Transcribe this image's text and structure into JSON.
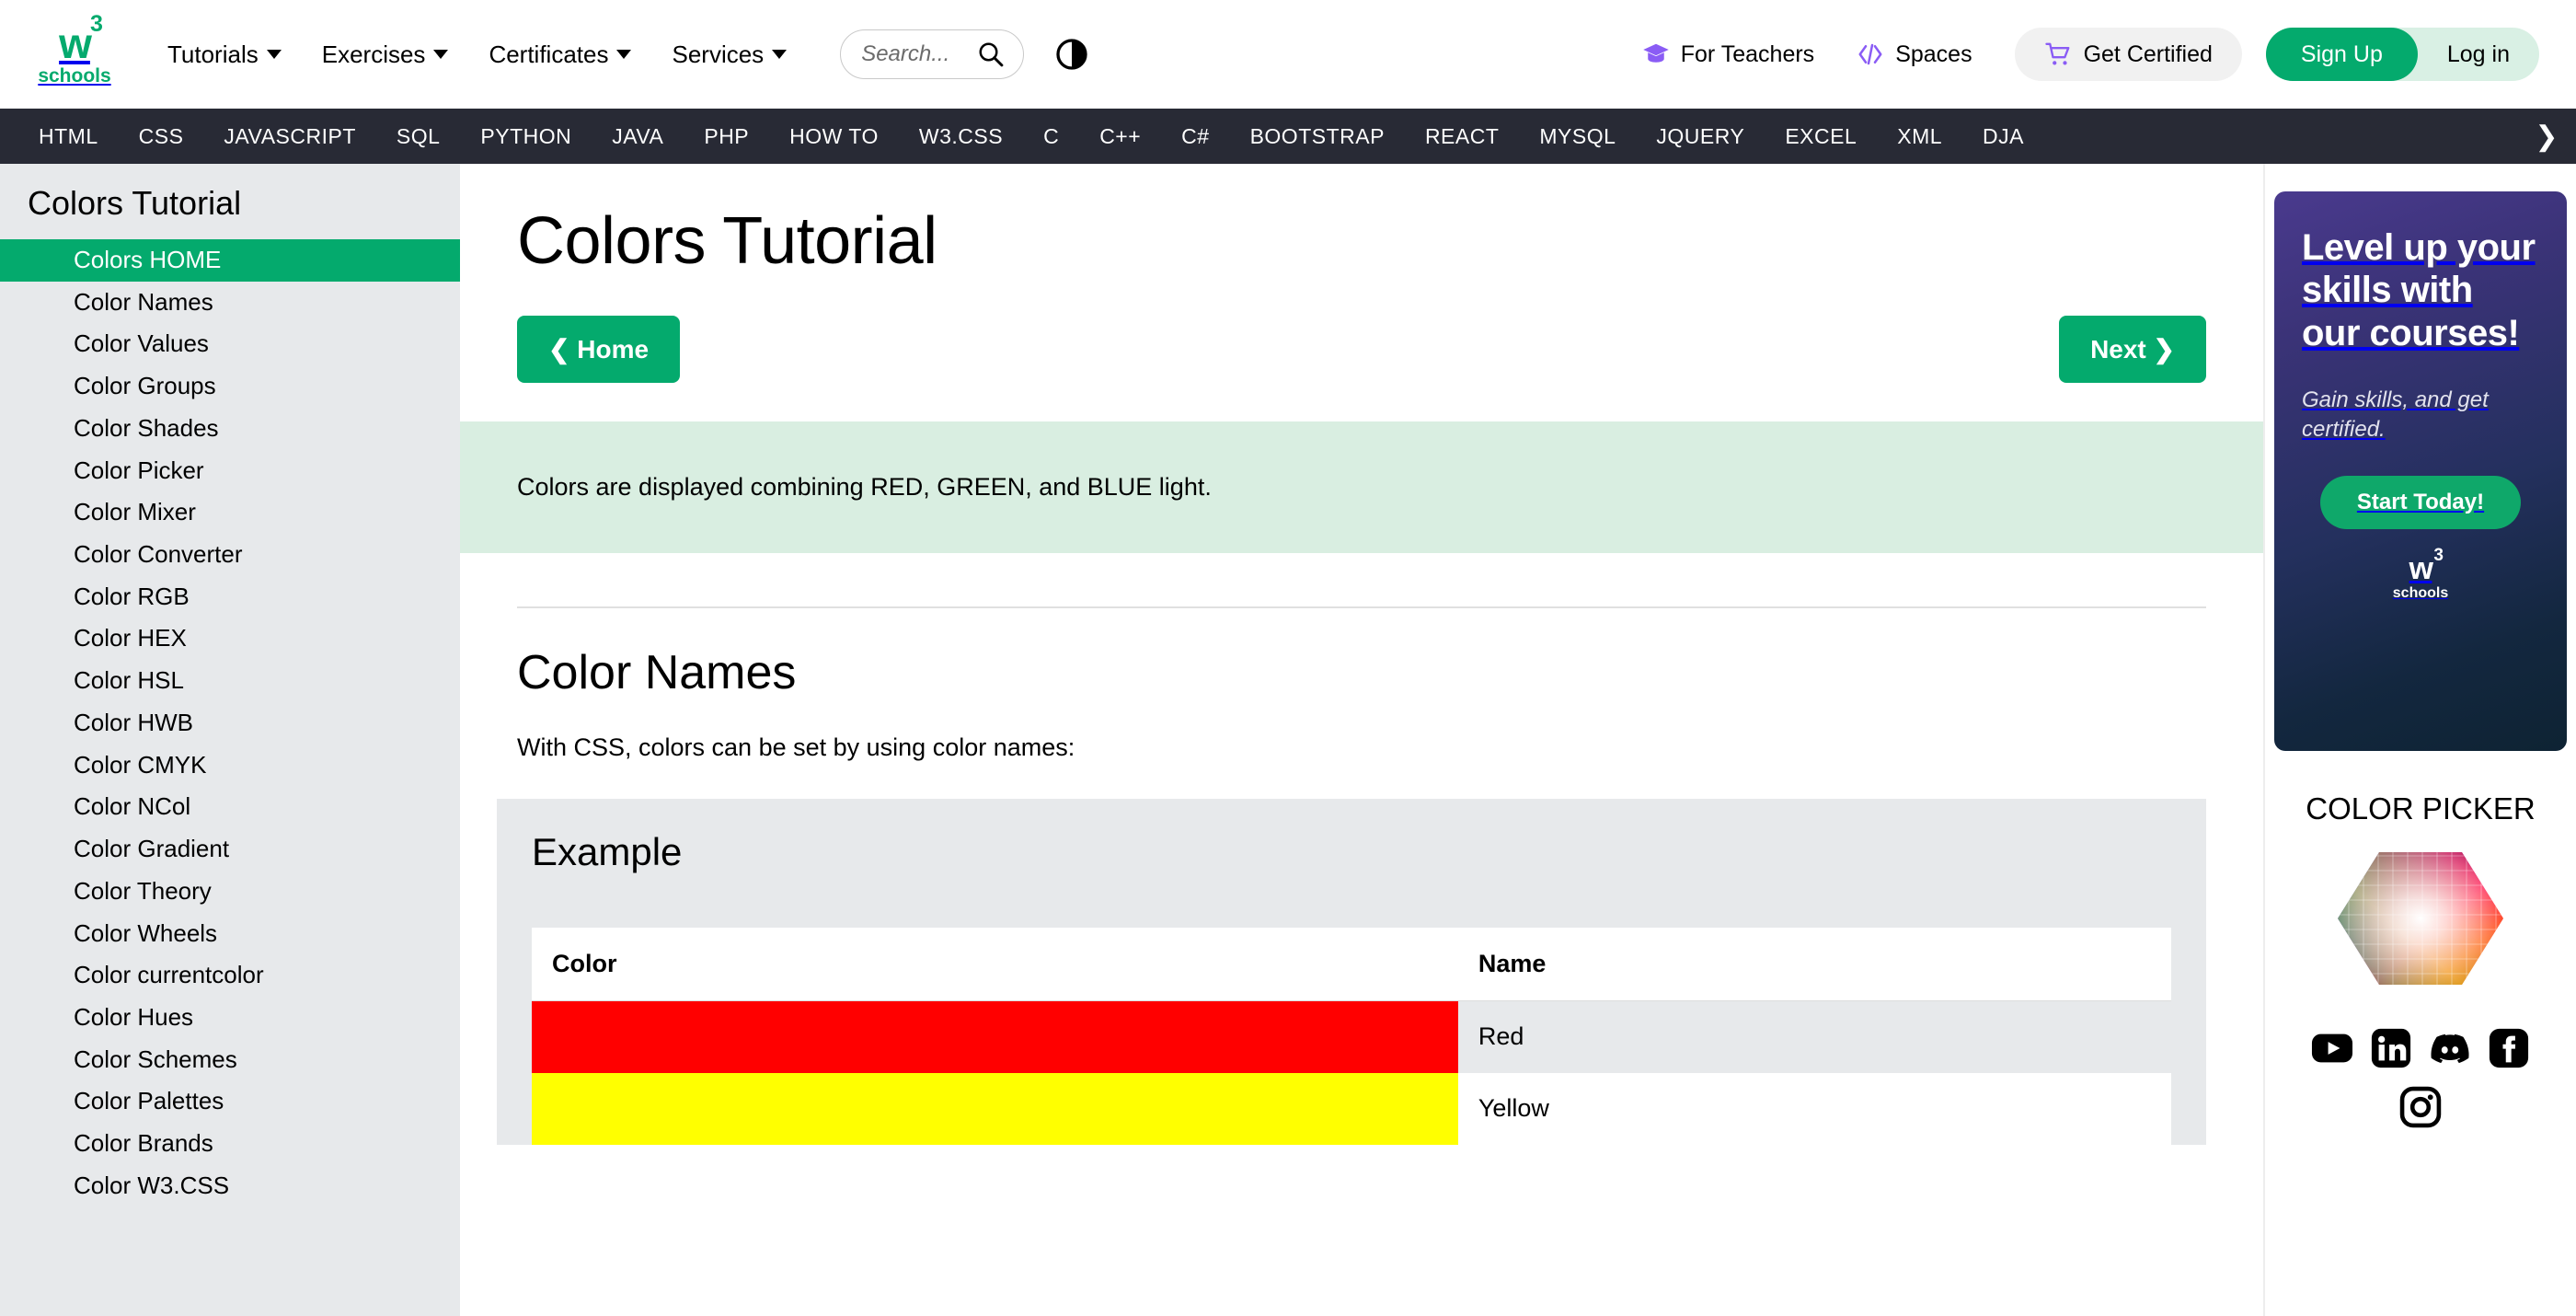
{
  "header": {
    "logo": {
      "mark": "w",
      "super": "3",
      "sub": "schools"
    },
    "menu": [
      {
        "label": "Tutorials",
        "has_caret": true
      },
      {
        "label": "Exercises",
        "has_caret": true
      },
      {
        "label": "Certificates",
        "has_caret": true
      },
      {
        "label": "Services",
        "has_caret": true
      }
    ],
    "search": {
      "placeholder": "Search...",
      "value": "",
      "icon": "search-icon"
    },
    "dark_mode_icon": "contrast-icon",
    "right_links": [
      {
        "label": "For Teachers",
        "icon": "graduation-cap-icon"
      },
      {
        "label": "Spaces",
        "icon": "code-brackets-icon"
      }
    ],
    "get_certified": {
      "label": "Get Certified",
      "icon": "shopping-cart-icon"
    },
    "sign_up": "Sign Up",
    "log_in": "Log in"
  },
  "nav": {
    "items": [
      "HTML",
      "CSS",
      "JAVASCRIPT",
      "SQL",
      "PYTHON",
      "JAVA",
      "PHP",
      "HOW TO",
      "W3.CSS",
      "C",
      "C++",
      "C#",
      "BOOTSTRAP",
      "REACT",
      "MYSQL",
      "JQUERY",
      "EXCEL",
      "XML",
      "DJA"
    ],
    "scroll_arrow": "❯"
  },
  "sidebar": {
    "title": "Colors Tutorial",
    "items": [
      {
        "label": "Colors HOME",
        "active": true
      },
      {
        "label": "Color Names",
        "active": false
      },
      {
        "label": "Color Values",
        "active": false
      },
      {
        "label": "Color Groups",
        "active": false
      },
      {
        "label": "Color Shades",
        "active": false
      },
      {
        "label": "Color Picker",
        "active": false
      },
      {
        "label": "Color Mixer",
        "active": false
      },
      {
        "label": "Color Converter",
        "active": false
      },
      {
        "label": "Color RGB",
        "active": false
      },
      {
        "label": "Color HEX",
        "active": false
      },
      {
        "label": "Color HSL",
        "active": false
      },
      {
        "label": "Color HWB",
        "active": false
      },
      {
        "label": "Color CMYK",
        "active": false
      },
      {
        "label": "Color NCol",
        "active": false
      },
      {
        "label": "Color Gradient",
        "active": false
      },
      {
        "label": "Color Theory",
        "active": false
      },
      {
        "label": "Color Wheels",
        "active": false
      },
      {
        "label": "Color currentcolor",
        "active": false
      },
      {
        "label": "Color Hues",
        "active": false
      },
      {
        "label": "Color Schemes",
        "active": false
      },
      {
        "label": "Color Palettes",
        "active": false
      },
      {
        "label": "Color Brands",
        "active": false
      },
      {
        "label": "Color W3.CSS",
        "active": false
      }
    ]
  },
  "main": {
    "title": "Colors Tutorial",
    "home_button": "❮ Home",
    "next_button": "Next ❯",
    "note": "Colors are displayed combining RED, GREEN, and BLUE light.",
    "section_title": "Color Names",
    "section_body": "With CSS, colors can be set by using color names:",
    "example_title": "Example",
    "table": {
      "headers": [
        "Color",
        "Name"
      ],
      "rows": [
        {
          "swatch": "#FF0000",
          "name": "Red"
        },
        {
          "swatch": "#FFFF00",
          "name": "Yellow"
        }
      ]
    }
  },
  "right": {
    "ad": {
      "headline": "Level up your skills with our courses!",
      "subtext": "Gain skills,\nand get certified.",
      "button": "Start Today!",
      "logo": {
        "mark": "w",
        "super": "3",
        "sub": "schools"
      }
    },
    "color_picker_title": "COLOR PICKER",
    "color_picker_icon": "hex-color-wheel-icon",
    "socials": [
      {
        "name": "youtube-icon"
      },
      {
        "name": "linkedin-icon"
      },
      {
        "name": "discord-icon"
      },
      {
        "name": "facebook-icon"
      },
      {
        "name": "instagram-icon"
      }
    ]
  },
  "colors": {
    "brand_green": "#04AA6D",
    "nav_dark": "#282A35",
    "sidebar_gray": "#E7E9EB",
    "note_green": "#D9EEE1",
    "purple_accent": "#8A5CF5"
  }
}
